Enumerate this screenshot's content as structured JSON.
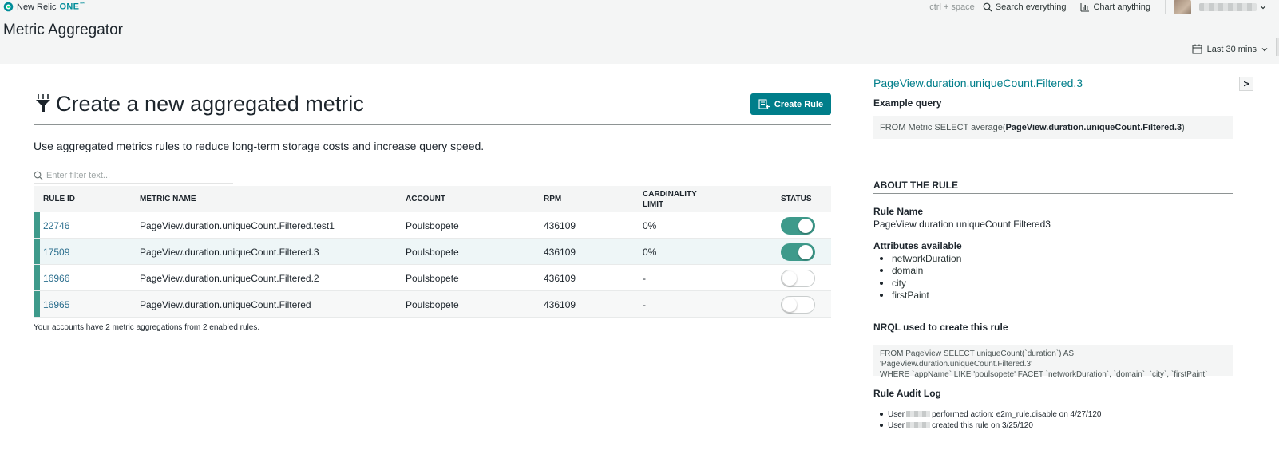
{
  "header": {
    "brand_name": "New Relic",
    "brand_product": "ONE",
    "brand_tm": "™",
    "page_title": "Metric Aggregator",
    "shortcut_hint": "ctrl + space",
    "search_label": "Search everything",
    "chart_label": "Chart anything",
    "time_range": "Last 30 mins"
  },
  "main": {
    "title": "Create a new aggregated metric",
    "create_button": "Create Rule",
    "description": "Use aggregated metrics rules to reduce long-term storage costs and increase query speed.",
    "filter_placeholder": "Enter filter text...",
    "columns": {
      "rule_id": "RULE ID",
      "metric_name": "METRIC NAME",
      "account": "ACCOUNT",
      "rpm": "RPM",
      "cardinality_line1": "CARDINALITY",
      "cardinality_line2": "LIMIT",
      "status": "STATUS"
    },
    "rows": [
      {
        "id": "22746",
        "metric": "PageView.duration.uniqueCount.Filtered.test1",
        "account": "Poulsbopete",
        "rpm": "436109",
        "cardinality": "0%",
        "enabled": true
      },
      {
        "id": "17509",
        "metric": "PageView.duration.uniqueCount.Filtered.3",
        "account": "Poulsbopete",
        "rpm": "436109",
        "cardinality": "0%",
        "enabled": true
      },
      {
        "id": "16966",
        "metric": "PageView.duration.uniqueCount.Filtered.2",
        "account": "Poulsbopete",
        "rpm": "436109",
        "cardinality": "-",
        "enabled": false
      },
      {
        "id": "16965",
        "metric": "PageView.duration.uniqueCount.Filtered",
        "account": "Poulsbopete",
        "rpm": "436109",
        "cardinality": "-",
        "enabled": false
      }
    ],
    "footnote": "Your accounts have 2 metric aggregations from 2 enabled rules."
  },
  "detail": {
    "collapse_label": ">",
    "title": "PageView.duration.uniqueCount.Filtered.3",
    "example_query_label": "Example query",
    "example_query_prefix": "FROM Metric SELECT average(",
    "example_query_metric": "PageView.duration.uniqueCount.Filtered.3",
    "example_query_suffix": ")",
    "about_heading": "ABOUT THE RULE",
    "rule_name_label": "Rule Name",
    "rule_name": "PageView duration uniqueCount Filtered3",
    "attributes_label": "Attributes available",
    "attributes": [
      "networkDuration",
      "domain",
      "city",
      "firstPaint"
    ],
    "nrql_label": "NRQL used to create this rule",
    "nrql_line1": "FROM PageView SELECT uniqueCount(`duration`) AS 'PageView.duration.uniqueCount.Filtered.3'",
    "nrql_line2": "WHERE `appName` LIKE 'poulsopete' FACET `networkDuration`, `domain`, `city`, `firstPaint`",
    "audit_label": "Rule Audit Log",
    "audit": [
      {
        "prefix": "User",
        "suffix": "performed action: e2m_rule.disable on 4/27/120"
      },
      {
        "prefix": "User",
        "suffix": "created this rule on 3/25/120"
      }
    ]
  },
  "colors": {
    "accent_teal": "#007e8a",
    "toggle_on": "#3e9a8b",
    "header_bg": "#f4f5f5"
  },
  "icons": [
    "new-relic-logo-icon",
    "search-icon",
    "chart-icon",
    "chevron-down-icon",
    "calendar-icon",
    "aggregate-icon",
    "create-rule-icon"
  ]
}
